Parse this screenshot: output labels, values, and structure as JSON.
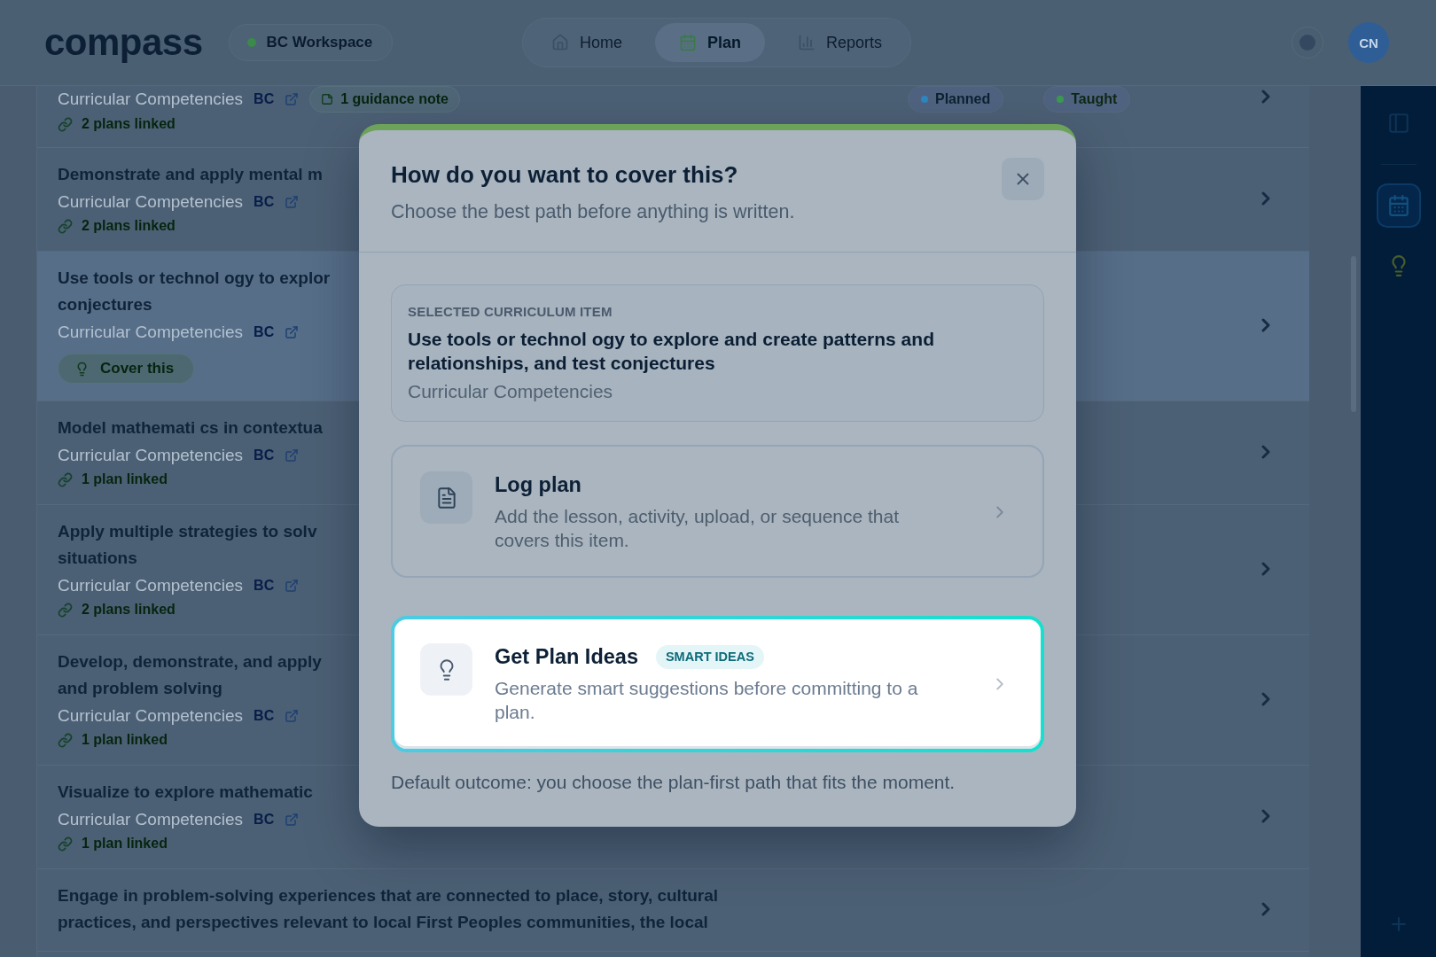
{
  "top_bar": {
    "logo": "compass",
    "workspace": "BC Workspace",
    "nav": [
      {
        "label": "Home",
        "selected": false
      },
      {
        "label": "Plan",
        "selected": true
      },
      {
        "label": "Reports",
        "selected": false
      }
    ],
    "avatar": "CN"
  },
  "curriculum_list": {
    "rows": [
      {
        "category": "Curricular Competencies",
        "region": "BC",
        "guidance_note": "1 guidance note",
        "linked": "2 plans linked",
        "statuses": [
          {
            "label": "Planned",
            "color": "#2e86c1"
          },
          {
            "label": "Taught",
            "color": "#3b9a52"
          }
        ],
        "selected": false
      },
      {
        "title_lines": [
          "Demonstrate and apply mental m"
        ],
        "category": "Curricular Competencies",
        "region": "BC",
        "linked": "2 plans linked",
        "selected": false
      },
      {
        "title_lines": [
          "Use tools or technol ogy to explor",
          "conjectures"
        ],
        "category": "Curricular Competencies",
        "region": "BC",
        "action": "Cover this",
        "selected": true
      },
      {
        "title_lines": [
          "Model mathemati cs in contextua"
        ],
        "category": "Curricular Competencies",
        "region": "BC",
        "linked": "1 plan linked",
        "selected": false
      },
      {
        "title_lines": [
          "Apply multiple strategies to solv",
          "situations"
        ],
        "category": "Curricular Competencies",
        "region": "BC",
        "linked": "2 plans linked",
        "selected": false
      },
      {
        "title_lines": [
          "Develop, demonstrate, and apply",
          "and problem solving"
        ],
        "category": "Curricular Competencies",
        "region": "BC",
        "linked": "1 plan linked",
        "selected": false
      },
      {
        "title_lines": [
          "Visualize to explore mathematic"
        ],
        "category": "Curricular Competencies",
        "region": "BC",
        "linked": "1 plan linked",
        "selected": false
      },
      {
        "title_lines": [
          "Engage in problem-solving experiences that are connected to place, story, cultural",
          "practices, and perspectives relevant to local First Peoples communities, the local"
        ],
        "selected": false
      }
    ]
  },
  "side_rail": {
    "items": [
      {
        "selected": false
      },
      {
        "selected": true
      },
      {
        "selected": false
      }
    ]
  },
  "dialog": {
    "title": "How do you want to cover this?",
    "subtitle": "Choose the best path before anything is written.",
    "selected_item": {
      "label": "SELECTED CURRICULUM ITEM",
      "title": "Use tools or technol ogy to explore and create patterns and relationships, and test conjectures",
      "category": "Curricular Competencies"
    },
    "options": [
      {
        "title": "Log plan",
        "description": "Add the lesson, activity, upload, or sequence that covers this item.",
        "selected": false
      },
      {
        "title": "Get Plan Ideas",
        "badge": "SMART IDEAS",
        "description": "Generate smart suggestions before committing to a plan.",
        "selected": true
      }
    ],
    "footer": "Default outcome: you choose the plan-first path that fits the moment."
  }
}
